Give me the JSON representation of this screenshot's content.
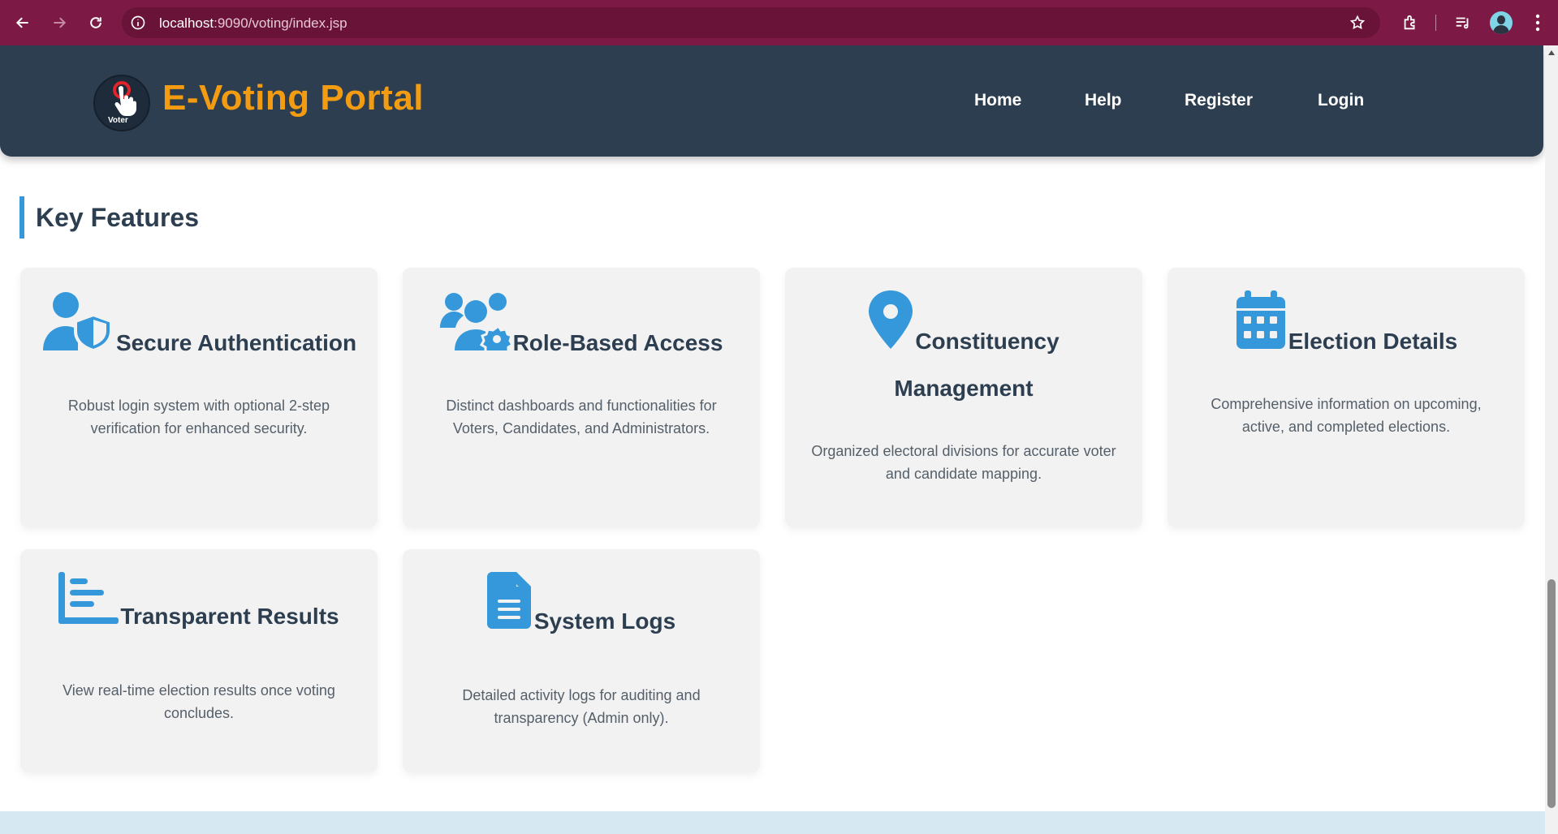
{
  "browser": {
    "url_host": "localhost",
    "url_path": ":9090/voting/index.jsp"
  },
  "header": {
    "logo_text": "Voter",
    "title": "E-Voting Portal",
    "nav": [
      "Home",
      "Help",
      "Register",
      "Login"
    ]
  },
  "section": {
    "title": "Key Features"
  },
  "features": [
    {
      "icon": "user-shield-icon",
      "title": "Secure Authentication",
      "description": "Robust login system with optional 2-step verification for enhanced security."
    },
    {
      "icon": "users-gear-icon",
      "title": "Role-Based Access",
      "description": "Distinct dashboards and functionalities for Voters, Candidates, and Administrators."
    },
    {
      "icon": "map-marker-icon",
      "title": "Constituency Management",
      "description": "Organized electoral divisions for accurate voter and candidate mapping."
    },
    {
      "icon": "calendar-icon",
      "title": "Election Details",
      "description": "Comprehensive information on upcoming, active, and completed elections."
    },
    {
      "icon": "chart-bars-icon",
      "title": "Transparent Results",
      "description": "View real-time election results once voting concludes."
    },
    {
      "icon": "file-text-icon",
      "title": "System Logs",
      "description": "Detailed activity logs for auditing and transparency (Admin only)."
    }
  ],
  "colors": {
    "browser_bar": "#7c1a45",
    "header_bg": "#2c3e50",
    "brand_orange": "#f39c12",
    "accent_blue": "#3498db"
  }
}
